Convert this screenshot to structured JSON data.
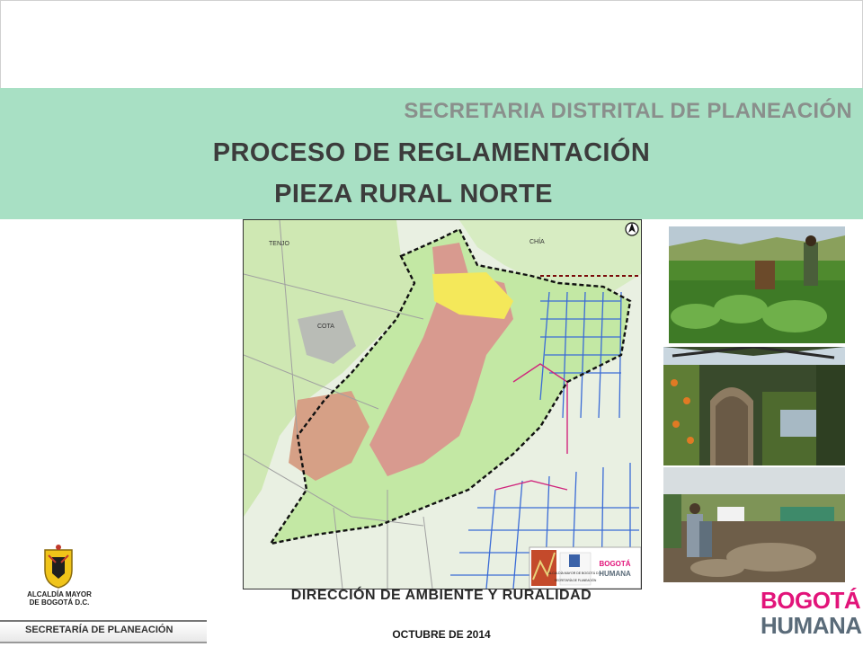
{
  "header": {
    "organization": "SECRETARIA DISTRITAL DE PLANEACIÓN",
    "title_line1": "PROCESO DE REGLAMENTACIÓN",
    "title_line2": "PIEZA RURAL NORTE"
  },
  "map": {
    "labels": [
      "TENJO",
      "CHÍA",
      "COTA"
    ],
    "north_arrow": "N",
    "logo_alcaldia": "ALCALDÍA MAYOR DE BOGOTÁ D.C.",
    "logo_secretaria": "SECRETARÍA DE PLANEACIÓN",
    "logo_bogota_line1": "BOGOTÁ",
    "logo_bogota_line2": "HUMANA"
  },
  "footer": {
    "department": "DIRECCIÓN DE AMBIENTE Y RURALIDAD",
    "date": "OCTUBRE DE 2014",
    "alcaldia_line1": "ALCALDÍA MAYOR",
    "alcaldia_line2": "DE BOGOTÁ D.C.",
    "secretaria": "SECRETARÍA DE PLANEACIÓN",
    "logo_line1": "BOGOTÁ",
    "logo_line2": "HUMANA"
  },
  "colors": {
    "banner": "#a8e0c4",
    "brand_magenta": "#e2147a",
    "brand_gray": "#5a6b79"
  }
}
